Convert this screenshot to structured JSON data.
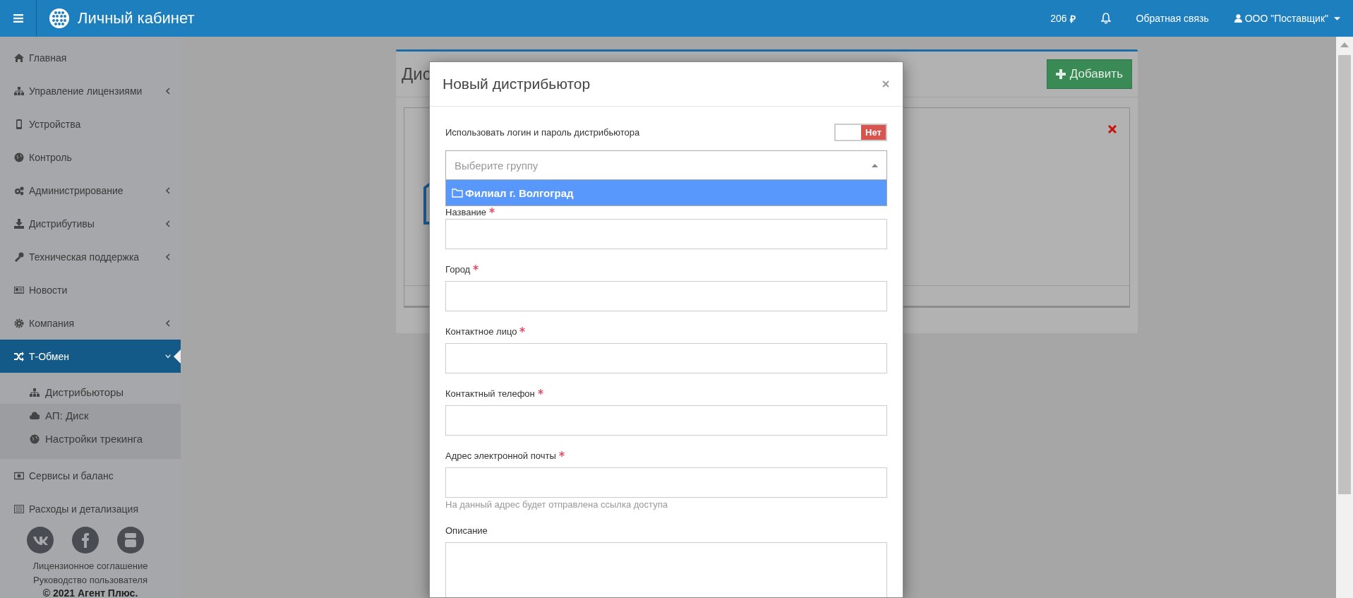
{
  "header": {
    "title": "Личный кабинет",
    "balance": "206",
    "currency": "₽",
    "feedback": "Обратная связь",
    "user": "ООО \"Поставщик\""
  },
  "sidebar": {
    "items": [
      {
        "label": "Главная",
        "submenu": false,
        "selected": false
      },
      {
        "label": "Управление лицензиями",
        "submenu": true,
        "expanded": false,
        "selected": false
      },
      {
        "label": "Устройства",
        "submenu": false,
        "selected": false
      },
      {
        "label": "Контроль",
        "submenu": false,
        "selected": false
      },
      {
        "label": "Администрирование",
        "submenu": true,
        "expanded": false,
        "selected": false
      },
      {
        "label": "Дистрибутивы",
        "submenu": true,
        "expanded": false,
        "selected": false
      },
      {
        "label": "Техническая поддержка",
        "submenu": true,
        "expanded": false,
        "selected": false
      },
      {
        "label": "Новости",
        "submenu": false,
        "selected": false
      },
      {
        "label": "Компания",
        "submenu": true,
        "expanded": false,
        "selected": false
      },
      {
        "label": "Т-Обмен",
        "submenu": true,
        "expanded": true,
        "selected": true,
        "children": [
          {
            "label": "Дистрибьюторы",
            "selected": true
          },
          {
            "label": "АП: Диск",
            "selected": false
          },
          {
            "label": "Настройки трекинга",
            "selected": false
          }
        ]
      },
      {
        "label": "Сервисы и баланс",
        "submenu": false,
        "selected": false
      },
      {
        "label": "Расходы и детализация",
        "submenu": false,
        "selected": false
      }
    ],
    "footer_links": [
      "Лицензионное соглашение",
      "Руководство пользователя"
    ],
    "copyright": "© 2021 Агент Плюс."
  },
  "page": {
    "title": "Дис",
    "add_button": "Добавить"
  },
  "modal": {
    "title": "Новый дистрибьютор",
    "toggle": {
      "label": "Использовать логин и пароль дистрибьютора",
      "on": false,
      "state_text": "Нет"
    },
    "select": {
      "placeholder": "Выберите группу",
      "expanded": true,
      "options": [
        {
          "label": "Филиал г. Волгоград",
          "selected": true
        }
      ]
    },
    "fields": [
      {
        "label": "Название",
        "required": true,
        "kind": "input"
      },
      {
        "label": "Город",
        "required": true,
        "kind": "input"
      },
      {
        "label": "Контактное лицо",
        "required": true,
        "kind": "input"
      },
      {
        "label": "Контактный телефон",
        "required": true,
        "kind": "input"
      },
      {
        "label": "Адрес электронной почты",
        "required": true,
        "kind": "input",
        "help": "На данный адрес будет отправлена ссылка доступа"
      },
      {
        "label": "Описание",
        "required": false,
        "kind": "textarea"
      }
    ]
  }
}
